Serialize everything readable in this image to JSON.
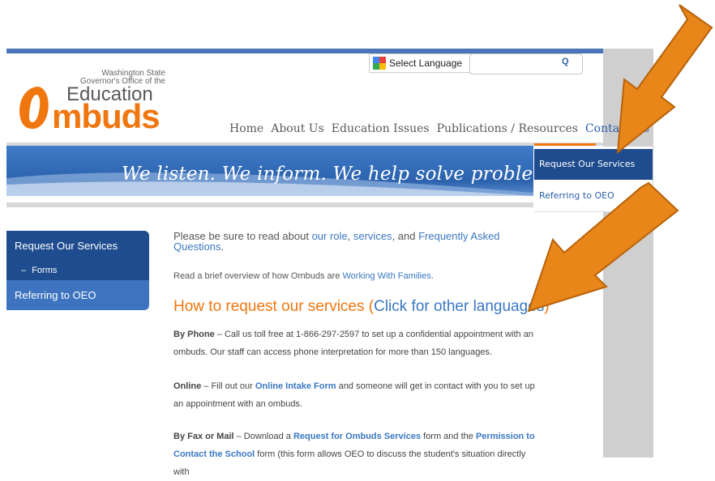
{
  "logo": {
    "line1": "Washington State",
    "line2": "Governor's Office of the",
    "education": "Education",
    "ombuds": "mbuds",
    "brand_color": "#f0760f"
  },
  "translate": {
    "label": "Select Language",
    "caret": "▼"
  },
  "search": {
    "icon": "search-icon",
    "glyph": "Q"
  },
  "nav": {
    "items": [
      "Home",
      "About Us",
      "Education Issues",
      "Publications / Resources",
      "Contact Us"
    ],
    "active_index": 4
  },
  "banner": {
    "tagline": "We listen.  We inform.  We help solve problems."
  },
  "dropdown": {
    "items": [
      "Request Our Services",
      "Referring to OEO"
    ]
  },
  "sidebar": {
    "items": [
      {
        "label": "Request Our Services"
      },
      {
        "label": "Forms",
        "prefix": "–"
      },
      {
        "label": "Referring to OEO"
      }
    ]
  },
  "content": {
    "p1_pre": "Please be sure to read about ",
    "p1_link1": "our role",
    "p1_sep1": ", ",
    "p1_link2": "services",
    "p1_sep2": ", and ",
    "p1_link3": "Frequently Asked Questions",
    "p1_end": ".",
    "p2_pre": "Read a brief overview of how Ombuds are ",
    "p2_link": "Working With Families",
    "p2_end": ".",
    "heading_pre": "How to request our services (",
    "heading_link": "Click for other languages",
    "heading_end": ")",
    "phone_label": "By Phone",
    "phone_text": " – Call us toll free at 1-866-297-2597 to set up a confidential appointment with an ombuds. Our staff can access phone interpretation for more than 150 languages.",
    "online_label": "Online",
    "online_pre": " – Fill out our ",
    "online_link": "Online Intake Form",
    "online_text": " and someone will get in contact with you to set up an appointment with an ombuds.",
    "fax_label": "By Fax or Mail",
    "fax_pre": " – Download a ",
    "fax_link1": "Request for Ombuds Services",
    "fax_mid": " form and the ",
    "fax_link2": "Permission to Contact the School",
    "fax_text": " form (this form allows OEO to discuss the student's situation directly with"
  },
  "colors": {
    "nav_blue": "#2a5fa8",
    "dark_blue": "#1f4c8e",
    "arrow_orange": "#e8861a"
  }
}
